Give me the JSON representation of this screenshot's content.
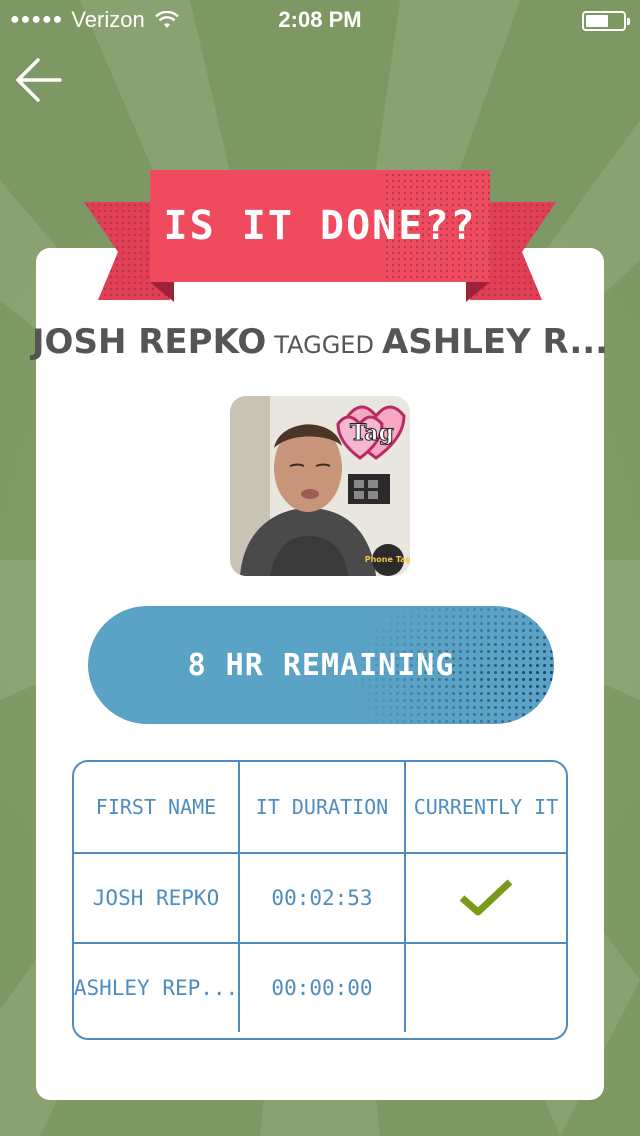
{
  "status_bar": {
    "signal": "●●●●●",
    "carrier": "Verizon",
    "time": "2:08 PM"
  },
  "banner": {
    "title": "IS IT DONE??",
    "color": "#f04a5f"
  },
  "tag": {
    "tagger": "JOSH REPKO",
    "verb": "TAGGED",
    "tagged": "ASHLEY R..."
  },
  "photo": {
    "sticker_text": "Tag",
    "watermark": "Phone Tag"
  },
  "remaining": {
    "label": "8 HR REMAINING",
    "color": "#5aa2c6"
  },
  "table": {
    "headers": [
      "FIRST NAME",
      "IT DURATION",
      "CURRENTLY IT"
    ],
    "rows": [
      {
        "name": "JOSH REPKO",
        "duration": "00:02:53",
        "currently_it": true
      },
      {
        "name": "ASHLEY REP...",
        "duration": "00:00:00",
        "currently_it": false
      }
    ],
    "accent": "#4f8dc0",
    "check_color": "#7a9a1a"
  },
  "icons": {
    "back": "back-arrow-icon",
    "wifi": "wifi-icon",
    "battery": "battery-icon",
    "check": "check-icon"
  }
}
